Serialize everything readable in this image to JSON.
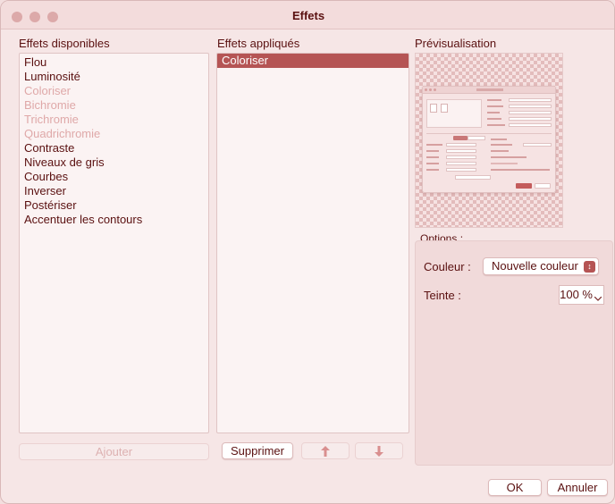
{
  "window": {
    "title": "Effets"
  },
  "available": {
    "label": "Effets disponibles",
    "items": [
      {
        "label": "Flou",
        "disabled": false
      },
      {
        "label": "Luminosité",
        "disabled": false
      },
      {
        "label": "Coloriser",
        "disabled": true
      },
      {
        "label": "Bichromie",
        "disabled": true
      },
      {
        "label": "Trichromie",
        "disabled": true
      },
      {
        "label": "Quadrichromie",
        "disabled": true
      },
      {
        "label": "Contraste",
        "disabled": false
      },
      {
        "label": "Niveaux de gris",
        "disabled": false
      },
      {
        "label": "Courbes",
        "disabled": false
      },
      {
        "label": "Inverser",
        "disabled": false
      },
      {
        "label": "Postériser",
        "disabled": false
      },
      {
        "label": "Accentuer les contours",
        "disabled": false
      }
    ],
    "add_button": "Ajouter"
  },
  "applied": {
    "label": "Effets appliqués",
    "items": [
      {
        "label": "Coloriser",
        "selected": true
      }
    ],
    "remove_button": "Supprimer"
  },
  "preview": {
    "label": "Prévisualisation"
  },
  "options": {
    "label": "Options :",
    "color_label": "Couleur :",
    "color_value": "Nouvelle couleur",
    "tint_label": "Teinte :",
    "tint_value": "100 %"
  },
  "footer": {
    "ok": "OK",
    "cancel": "Annuler"
  },
  "colors": {
    "accent": "#b55454",
    "text": "#5a1010",
    "disabled_text": "#dfa8a8"
  },
  "icons": {
    "move_up": "arrow-up-icon",
    "move_down": "arrow-down-icon"
  }
}
